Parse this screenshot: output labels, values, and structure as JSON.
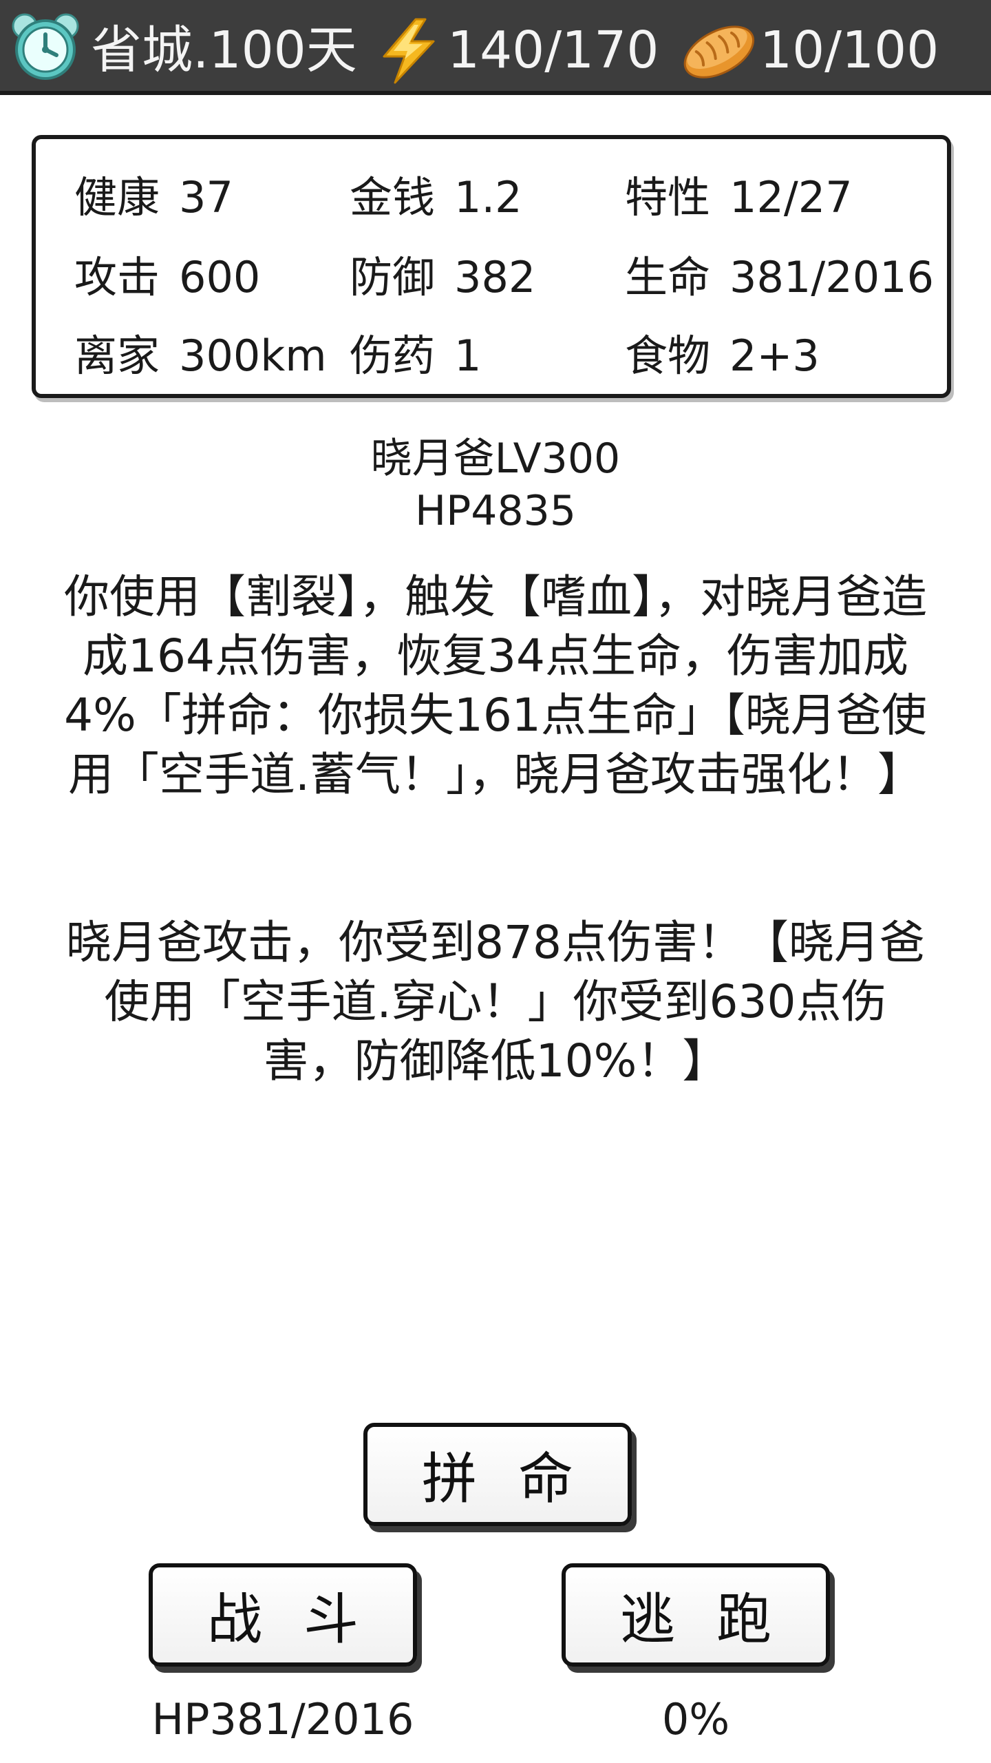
{
  "status_bar": {
    "location_day": "省城.100天",
    "energy": "140/170",
    "food": "10/100"
  },
  "stats": {
    "health": {
      "label": "健康",
      "value": "37"
    },
    "money": {
      "label": "金钱",
      "value": "1.2"
    },
    "traits": {
      "label": "特性",
      "value": "12/27"
    },
    "attack": {
      "label": "攻击",
      "value": "600"
    },
    "defense": {
      "label": "防御",
      "value": "382"
    },
    "life": {
      "label": "生命",
      "value": "381/2016"
    },
    "distance": {
      "label": "离家",
      "value": "300km"
    },
    "medicine": {
      "label": "伤药",
      "value": "1"
    },
    "food_items": {
      "label": "食物",
      "value": "2+3"
    }
  },
  "enemy": {
    "name_level": "晓月爸LV300",
    "hp": "HP4835"
  },
  "battle_log": [
    "你使用【割裂】，触发【嗜血】，对晓月爸造成164点伤害，恢复34点生命，伤害加成4%「拼命：你损失161点生命」【晓月爸使用「空手道.蓄气！」，晓月爸攻击强化！】",
    "晓月爸攻击，你受到878点伤害！【晓月爸使用「空手道.穿心！」你受到630点伤害，防御降低10%！】"
  ],
  "buttons": {
    "desperate": "拼命",
    "fight": "战斗",
    "flee": "逃跑"
  },
  "readouts": {
    "player_hp": "HP381/2016",
    "flee_chance": "0%"
  },
  "icons": {
    "clock": "alarm-clock-icon",
    "energy": "lightning-bolt-icon",
    "food": "bread-icon"
  },
  "colors": {
    "topbar_bg": "#3d3d3d",
    "bolt": "#f5b820",
    "bread": "#e8952c",
    "clock": "#5cc7c2"
  }
}
